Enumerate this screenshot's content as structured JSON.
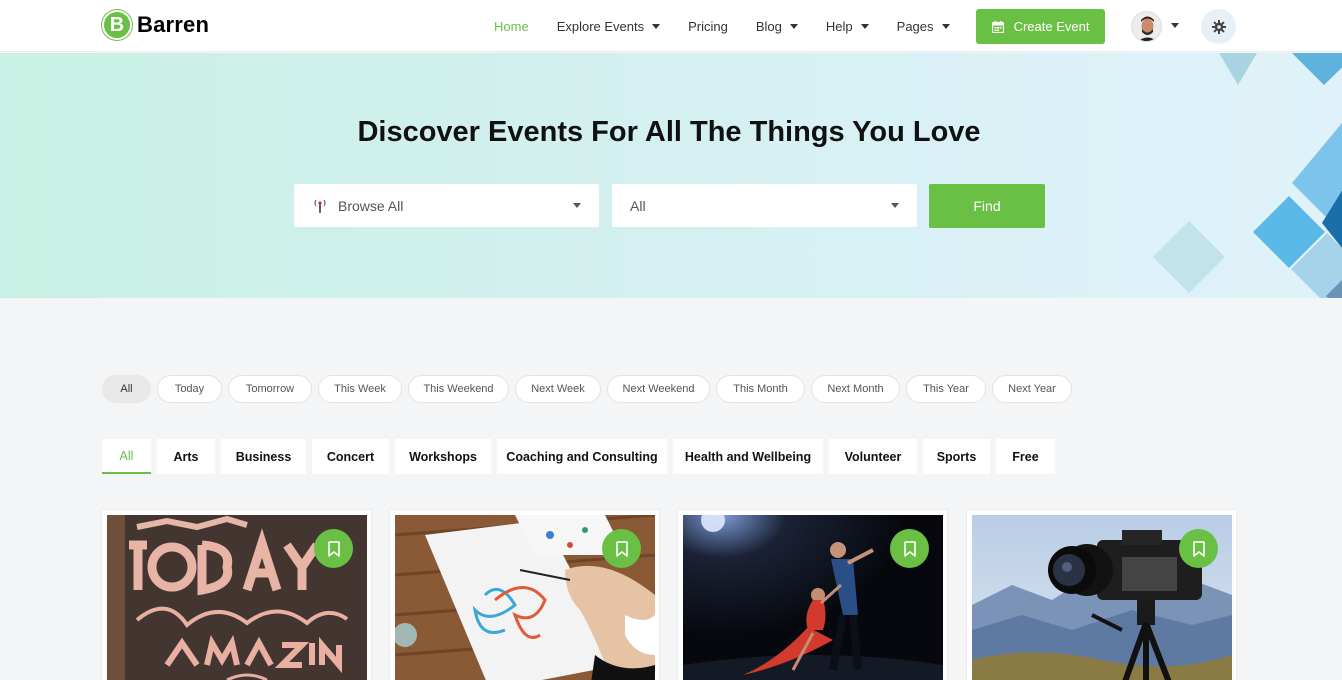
{
  "brand": {
    "logo_letter": "B",
    "name": "Barren",
    "accent": "#6ac045"
  },
  "nav": {
    "items": [
      {
        "label": "Home",
        "active": true,
        "dropdown": false
      },
      {
        "label": "Explore Events",
        "active": false,
        "dropdown": true
      },
      {
        "label": "Pricing",
        "active": false,
        "dropdown": false
      },
      {
        "label": "Blog",
        "active": false,
        "dropdown": true
      },
      {
        "label": "Help",
        "active": false,
        "dropdown": true
      },
      {
        "label": "Pages",
        "active": false,
        "dropdown": true
      }
    ],
    "create_event_label": "Create Event",
    "create_event_icon": "calendar-icon",
    "theme_icon": "gear-icon"
  },
  "hero": {
    "title": "Discover Events For All The Things You Love",
    "browse_select": {
      "value": "Browse All",
      "icon": "broadcast-icon"
    },
    "location_select": {
      "value": "All"
    },
    "find_label": "Find"
  },
  "time_filters": [
    "All",
    "Today",
    "Tomorrow",
    "This Week",
    "This Weekend",
    "Next Week",
    "Next Weekend",
    "This Month",
    "Next Month",
    "This Year",
    "Next Year"
  ],
  "time_filters_active": "All",
  "categories": [
    "All",
    "Arts",
    "Business",
    "Concert",
    "Workshops",
    "Coaching and Consulting",
    "Health and Wellbeing",
    "Volunteer",
    "Sports",
    "Free"
  ],
  "categories_active": "All",
  "cards": [
    {
      "image": "chalkboard-lettering-image",
      "bookmark_icon": "bookmark-icon"
    },
    {
      "image": "painting-art-image",
      "bookmark_icon": "bookmark-icon"
    },
    {
      "image": "tango-dance-image",
      "bookmark_icon": "bookmark-icon"
    },
    {
      "image": "camera-landscape-image",
      "bookmark_icon": "bookmark-icon"
    }
  ]
}
